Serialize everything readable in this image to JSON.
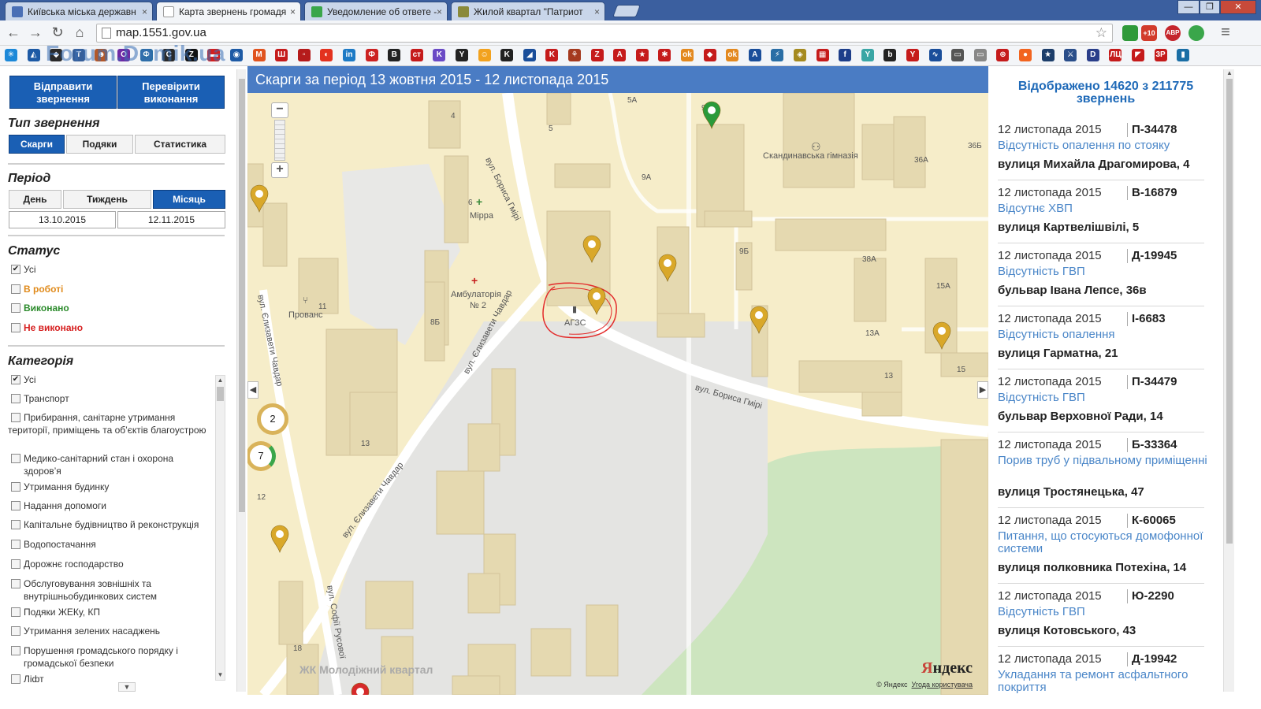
{
  "browser": {
    "tabs": [
      {
        "label": "Київська міська державн",
        "color": "#4a6fb5"
      },
      {
        "label": "Карта звернень громадя",
        "color": "#ffffff"
      },
      {
        "label": "Уведомление об ответе -",
        "color": "#3aa64a"
      },
      {
        "label": "Жилой квартал \"Патриот",
        "color": "#8a8a3a"
      }
    ],
    "tab_close": "×",
    "window_controls": [
      "—",
      "❐",
      "✕"
    ],
    "url": "map.1551.gov.ua",
    "nav_back": "←",
    "nav_forward": "→",
    "nav_reload": "↻",
    "nav_home": "⌂",
    "star": "☆",
    "menu": "≡",
    "extensions": [
      {
        "label": "",
        "color": "#2f9a3a"
      },
      {
        "label": "+10",
        "color": "#d23b2b"
      },
      {
        "label": "ABP",
        "color": "#c5252c"
      },
      {
        "label": "",
        "color": "#3aa64a"
      }
    ],
    "bookmarks": [
      {
        "label": "✳",
        "color": "#1c88d8"
      },
      {
        "label": "◭",
        "color": "#1d5aa5"
      },
      {
        "label": "◆",
        "color": "#2a2a2a"
      },
      {
        "label": "T",
        "color": "#365f9a"
      },
      {
        "label": "☻",
        "color": "#b2582a"
      },
      {
        "label": "O",
        "color": "#6e2aa5"
      },
      {
        "label": "Ф",
        "color": "#2a6ea5"
      },
      {
        "label": "C",
        "color": "#2a2a2a"
      },
      {
        "label": "Z",
        "color": "#111111"
      },
      {
        "label": "▬",
        "color": "#d21f1f"
      },
      {
        "label": "◉",
        "color": "#1d5aa5"
      },
      {
        "label": "M",
        "color": "#e0531f"
      },
      {
        "label": "Ш",
        "color": "#c51b1b"
      },
      {
        "label": "▫",
        "color": "#b51b1b"
      },
      {
        "label": "◐",
        "color": "#e3321f"
      },
      {
        "label": "in",
        "color": "#1d7ac5"
      },
      {
        "label": "Ф",
        "color": "#cc2222"
      },
      {
        "label": "B",
        "color": "#222222"
      },
      {
        "label": "ст",
        "color": "#c51b1b"
      },
      {
        "label": "K",
        "color": "#6a4ac5"
      },
      {
        "label": "Y",
        "color": "#222222"
      },
      {
        "label": "☺",
        "color": "#f2a21f"
      },
      {
        "label": "K",
        "color": "#222222"
      },
      {
        "label": "◢",
        "color": "#1a4e9a"
      },
      {
        "label": "K",
        "color": "#c51b1b"
      },
      {
        "label": "⚘",
        "color": "#a53a1f"
      },
      {
        "label": "Z",
        "color": "#c51b1b"
      },
      {
        "label": "A",
        "color": "#c51b1b"
      },
      {
        "label": "★",
        "color": "#c51b1b"
      },
      {
        "label": "✱",
        "color": "#c51b1b"
      },
      {
        "label": "ok",
        "color": "#e3891f"
      },
      {
        "label": "◆",
        "color": "#c51b1b"
      },
      {
        "label": "ok",
        "color": "#e3891f"
      },
      {
        "label": "A",
        "color": "#1a4e9a"
      },
      {
        "label": "⚡",
        "color": "#2a6ea5"
      },
      {
        "label": "◈",
        "color": "#a58a1f"
      },
      {
        "label": "▦",
        "color": "#c51b1b"
      },
      {
        "label": "f",
        "color": "#1d3e8a"
      },
      {
        "label": "Y",
        "color": "#3aa6a5"
      },
      {
        "label": "b",
        "color": "#222222"
      },
      {
        "label": "Y",
        "color": "#c51b1b"
      },
      {
        "label": "∿",
        "color": "#1a4e9a"
      },
      {
        "label": "▭",
        "color": "#555555"
      },
      {
        "label": "▭",
        "color": "#888888"
      },
      {
        "label": "⊛",
        "color": "#c51b1b"
      },
      {
        "label": "●",
        "color": "#f2641f"
      },
      {
        "label": "★",
        "color": "#1d3e6a"
      },
      {
        "label": "⚔",
        "color": "#2a4e8a"
      },
      {
        "label": "D",
        "color": "#2a3e8a"
      },
      {
        "label": "ЛЦ",
        "color": "#c51b1b"
      },
      {
        "label": "◤",
        "color": "#c51b1b"
      },
      {
        "label": "3Р",
        "color": "#c51b1b"
      },
      {
        "label": "▮",
        "color": "#1a6ea5"
      }
    ],
    "watermark": "Forum.Domik.ua"
  },
  "left": {
    "send_button": "Відправити звернення",
    "check_button": "Перевірити виконання",
    "type_title": "Тип звернення",
    "type_options": [
      "Скарги",
      "Подяки",
      "Статистика"
    ],
    "period_title": "Період",
    "period_options": [
      "День",
      "Тиждень",
      "Місяць"
    ],
    "date_from": "13.10.2015",
    "date_to": "12.11.2015",
    "status_title": "Статус",
    "status_options": [
      {
        "label": "Усі",
        "checked": true,
        "color": "#333333"
      },
      {
        "label": "В роботі",
        "checked": false,
        "color": "#e08a1a"
      },
      {
        "label": "Виконано",
        "checked": false,
        "color": "#2a8a2a"
      },
      {
        "label": "Не виконано",
        "checked": false,
        "color": "#d61f1f"
      }
    ],
    "category_title": "Категорія",
    "categories": [
      {
        "label": "Усі",
        "checked": true
      },
      {
        "label": "Транспорт",
        "checked": false
      },
      {
        "label": "Прибирання, санітарне утримання території, приміщень та об’єктів благоустрою",
        "checked": false
      },
      {
        "label": "Медико-санітарний стан і охорона здоров’я",
        "checked": false
      },
      {
        "label": "Утримання будинку",
        "checked": false
      },
      {
        "label": "Надання допомоги",
        "checked": false
      },
      {
        "label": "Капітальне будівництво й реконструкція",
        "checked": false
      },
      {
        "label": "Водопостачання",
        "checked": false
      },
      {
        "label": "Дорожнє господарство",
        "checked": false
      },
      {
        "label": "Обслуговування зовнішніх та внутрішньобудинкових систем",
        "checked": false
      },
      {
        "label": "Подяки ЖЕКу, КП",
        "checked": false
      },
      {
        "label": "Утримання зелених насаджень",
        "checked": false
      },
      {
        "label": "Порушення громадського порядку і громадської безпеки",
        "checked": false
      },
      {
        "label": "Ліфт",
        "checked": false
      }
    ]
  },
  "map": {
    "header": "Скарги за період 13 жовтня 2015 - 12 листопада 2015",
    "zoom_in": "+",
    "zoom_out": "−",
    "arrow_left": "◀",
    "arrow_right": "▶",
    "labels": [
      {
        "text": "вул. Бориса Гмірі",
        "rot": "64"
      },
      {
        "text": "вул. Бориса Гмірі",
        "rot": "16"
      },
      {
        "text": "вул. Єлизавети Чавдар",
        "rot": "-62"
      },
      {
        "text": "вул. Єлизавети Чавдар",
        "rot": "-52"
      },
      {
        "text": "вул. Єлизавети Чавдар",
        "rot": "78"
      },
      {
        "text": "вул. Софії Русової",
        "rot": "80"
      },
      {
        "text": "Скандинавська гімназія",
        "rot": "0"
      },
      {
        "text": "Мірра",
        "rot": "0"
      },
      {
        "text": "Амбулаторія",
        "rot": "0"
      },
      {
        "text": "№ 2",
        "rot": "0"
      },
      {
        "text": "Прованс",
        "rot": "0"
      },
      {
        "text": "АГЗС",
        "rot": "0"
      },
      {
        "text": "ЖК Молодіжний квартал",
        "rot": "0"
      }
    ],
    "house_numbers": [
      "4",
      "5",
      "5А",
      "9",
      "9А",
      "9Б",
      "36Б",
      "36А",
      "38А",
      "15А",
      "13А",
      "13",
      "15",
      "6",
      "8Б",
      "11",
      "13",
      "12",
      "18"
    ],
    "clusters": [
      "2",
      "7"
    ],
    "yandex_logo_red": "Я",
    "yandex_logo_black": "ндекс",
    "copyright": "© Яндекс",
    "terms": "Угода користувача",
    "pin_colors": {
      "yellow": "#d9a82a",
      "green": "#2a9a3a",
      "red": "#d62a2a"
    }
  },
  "right": {
    "title": "Відображено 14620 з 211775 звернень",
    "items": [
      {
        "date": "12 листопада 2015",
        "number": "П-34478",
        "topic": "Відсутність опалення по стояку",
        "address": "вулиця Михайла Драгомирова, 4"
      },
      {
        "date": "12 листопада 2015",
        "number": "В-16879",
        "topic": "Відсутнє ХВП",
        "address": "вулиця Картвелішвілі, 5"
      },
      {
        "date": "12 листопада 2015",
        "number": "Д-19945",
        "topic": "Відсутність ГВП",
        "address": "бульвар Івана Лепсе, 36в"
      },
      {
        "date": "12 листопада 2015",
        "number": "І-6683",
        "topic": "Відсутність опалення",
        "address": "вулиця Гарматна, 21"
      },
      {
        "date": "12 листопада 2015",
        "number": "П-34479",
        "topic": "Відсутність ГВП",
        "address": "бульвар Верховної Ради, 14"
      },
      {
        "date": "12 листопада 2015",
        "number": "Б-33364",
        "topic": "Порив труб у підвальному приміщенні",
        "address": "вулиця Тростянецька, 47"
      },
      {
        "date": "12 листопада 2015",
        "number": "К-60065",
        "topic": "Питання, що стосуються домофонної системи",
        "address": "вулиця полковника Потехіна, 14"
      },
      {
        "date": "12 листопада 2015",
        "number": "Ю-2290",
        "topic": "Відсутність ГВП",
        "address": "вулиця Котовського, 43"
      },
      {
        "date": "12 листопада 2015",
        "number": "Д-19942",
        "topic": "Укладання та ремонт асфальтного покриття",
        "address": ""
      }
    ]
  }
}
